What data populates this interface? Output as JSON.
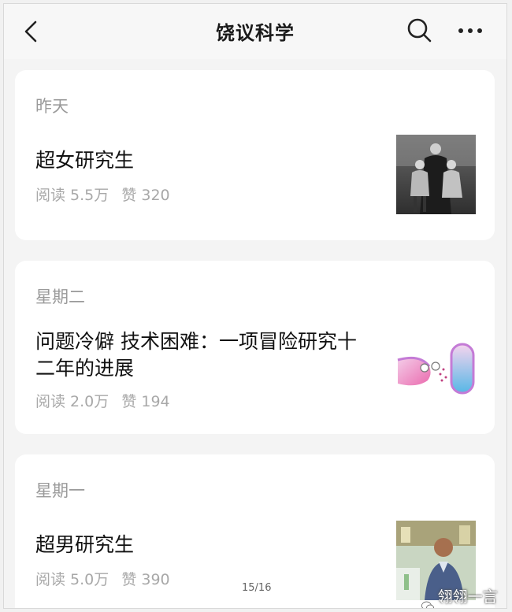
{
  "header": {
    "title": "饶议科学",
    "back_icon": "chevron-left-icon",
    "search_icon": "search-icon",
    "more_icon": "more-dots-icon"
  },
  "articles": [
    {
      "date": "昨天",
      "title": "超女研究生",
      "reads": "阅读 5.5万",
      "likes": "赞 320"
    },
    {
      "date": "星期二",
      "title_line1": "问题冷僻 技术困难：一项冒险研究十",
      "title_line2": "二年的进展",
      "reads": "阅读 2.0万",
      "likes": "赞 194"
    },
    {
      "date": "星期一",
      "title": "超男研究生",
      "reads": "阅读 5.0万",
      "likes": "赞 390"
    }
  ],
  "footer": {
    "page_indicator": "15/16",
    "watermark": "翎翎一言堂"
  },
  "colors": {
    "background": "#f4f4f4",
    "card": "#ffffff",
    "title_text": "#111111",
    "muted_text": "#9a9a9a"
  }
}
